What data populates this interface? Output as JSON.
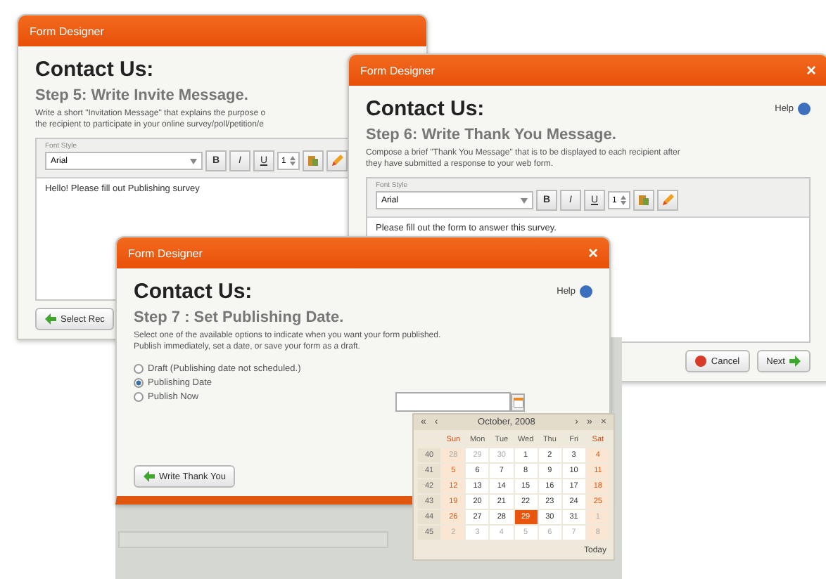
{
  "windows": [
    {
      "title": "Form Designer",
      "heading": "Contact Us:",
      "step": "Step 5: Write Invite Message.",
      "description": [
        "Write a short \"Invitation Message\" that explains the purpose o",
        "the recipient to participate in your online survey/poll/petition/e"
      ],
      "editor": {
        "label": "Font Style",
        "font": "Arial",
        "bold": "B",
        "italic": "I",
        "underline": "U",
        "size": "1",
        "text": "Hello! Please fill out Publishing survey"
      },
      "buttons": [
        {
          "label": "Select Rec",
          "kind": "back"
        }
      ]
    },
    {
      "title": "Form Designer",
      "close": "×",
      "heading": "Contact Us:",
      "help": "Help",
      "step": "Step 6: Write Thank You Message.",
      "description": [
        "Compose a brief \"Thank You Message\" that is to be displayed to each recipient after",
        "they have submitted a response to your web form."
      ],
      "editor": {
        "label": "Font Style",
        "font": "Arial",
        "bold": "B",
        "italic": "I",
        "underline": "U",
        "size": "1",
        "text": "Please fill out the form to answer this survey."
      },
      "buttons": [
        {
          "label": "Cancel",
          "kind": "cancel"
        },
        {
          "label": "Next",
          "kind": "next"
        }
      ]
    },
    {
      "title": "Form Designer",
      "close": "×",
      "heading": "Contact Us:",
      "help": "Help",
      "step": "Step 7 : Set Publishing Date.",
      "description": [
        "Select one of the available options to indicate when you want your form published.",
        "Publish immediately, set a date, or save your form as a draft."
      ],
      "options": [
        {
          "label": "Draft (Publishing date not scheduled.)",
          "selected": false
        },
        {
          "label": "Publishing Date",
          "selected": true
        },
        {
          "label": "Publish Now",
          "selected": false
        }
      ],
      "buttons": [
        {
          "label": "Write Thank You",
          "kind": "back"
        }
      ]
    }
  ],
  "calendar": {
    "nav_left": [
      "«",
      "‹"
    ],
    "month": "October, 2008",
    "nav_right": [
      "›",
      "»"
    ],
    "close": "×",
    "weekdays": [
      "Sun",
      "Mon",
      "Tue",
      "Wed",
      "Thu",
      "Fri",
      "Sat"
    ],
    "weeks": [
      {
        "number": "40",
        "days": [
          {
            "day": "28",
            "other_month": true,
            "selected": false
          },
          {
            "day": "29",
            "other_month": true,
            "selected": false
          },
          {
            "day": "30",
            "other_month": true,
            "selected": false
          },
          {
            "day": "1",
            "other_month": false,
            "selected": false
          },
          {
            "day": "2",
            "other_month": false,
            "selected": false
          },
          {
            "day": "3",
            "other_month": false,
            "selected": false
          },
          {
            "day": "4",
            "other_month": false,
            "selected": false
          }
        ]
      },
      {
        "number": "41",
        "days": [
          {
            "day": "5",
            "other_month": false,
            "selected": false
          },
          {
            "day": "6",
            "other_month": false,
            "selected": false
          },
          {
            "day": "7",
            "other_month": false,
            "selected": false
          },
          {
            "day": "8",
            "other_month": false,
            "selected": false
          },
          {
            "day": "9",
            "other_month": false,
            "selected": false
          },
          {
            "day": "10",
            "other_month": false,
            "selected": false
          },
          {
            "day": "11",
            "other_month": false,
            "selected": false
          }
        ]
      },
      {
        "number": "42",
        "days": [
          {
            "day": "12",
            "other_month": false,
            "selected": false
          },
          {
            "day": "13",
            "other_month": false,
            "selected": false
          },
          {
            "day": "14",
            "other_month": false,
            "selected": false
          },
          {
            "day": "15",
            "other_month": false,
            "selected": false
          },
          {
            "day": "16",
            "other_month": false,
            "selected": false
          },
          {
            "day": "17",
            "other_month": false,
            "selected": false
          },
          {
            "day": "18",
            "other_month": false,
            "selected": false
          }
        ]
      },
      {
        "number": "43",
        "days": [
          {
            "day": "19",
            "other_month": false,
            "selected": false
          },
          {
            "day": "20",
            "other_month": false,
            "selected": false
          },
          {
            "day": "21",
            "other_month": false,
            "selected": false
          },
          {
            "day": "22",
            "other_month": false,
            "selected": false
          },
          {
            "day": "23",
            "other_month": false,
            "selected": false
          },
          {
            "day": "24",
            "other_month": false,
            "selected": false
          },
          {
            "day": "25",
            "other_month": false,
            "selected": false
          }
        ]
      },
      {
        "number": "44",
        "days": [
          {
            "day": "26",
            "other_month": false,
            "selected": false
          },
          {
            "day": "27",
            "other_month": false,
            "selected": false
          },
          {
            "day": "28",
            "other_month": false,
            "selected": false
          },
          {
            "day": "29",
            "other_month": false,
            "selected": true
          },
          {
            "day": "30",
            "other_month": false,
            "selected": false
          },
          {
            "day": "31",
            "other_month": false,
            "selected": false
          },
          {
            "day": "1",
            "other_month": true,
            "selected": false
          }
        ]
      },
      {
        "number": "45",
        "days": [
          {
            "day": "2",
            "other_month": true,
            "selected": false
          },
          {
            "day": "3",
            "other_month": true,
            "selected": false
          },
          {
            "day": "4",
            "other_month": true,
            "selected": false
          },
          {
            "day": "5",
            "other_month": true,
            "selected": false
          },
          {
            "day": "6",
            "other_month": true,
            "selected": false
          },
          {
            "day": "7",
            "other_month": true,
            "selected": false
          },
          {
            "day": "8",
            "other_month": true,
            "selected": false
          }
        ]
      }
    ],
    "today": "Today"
  }
}
